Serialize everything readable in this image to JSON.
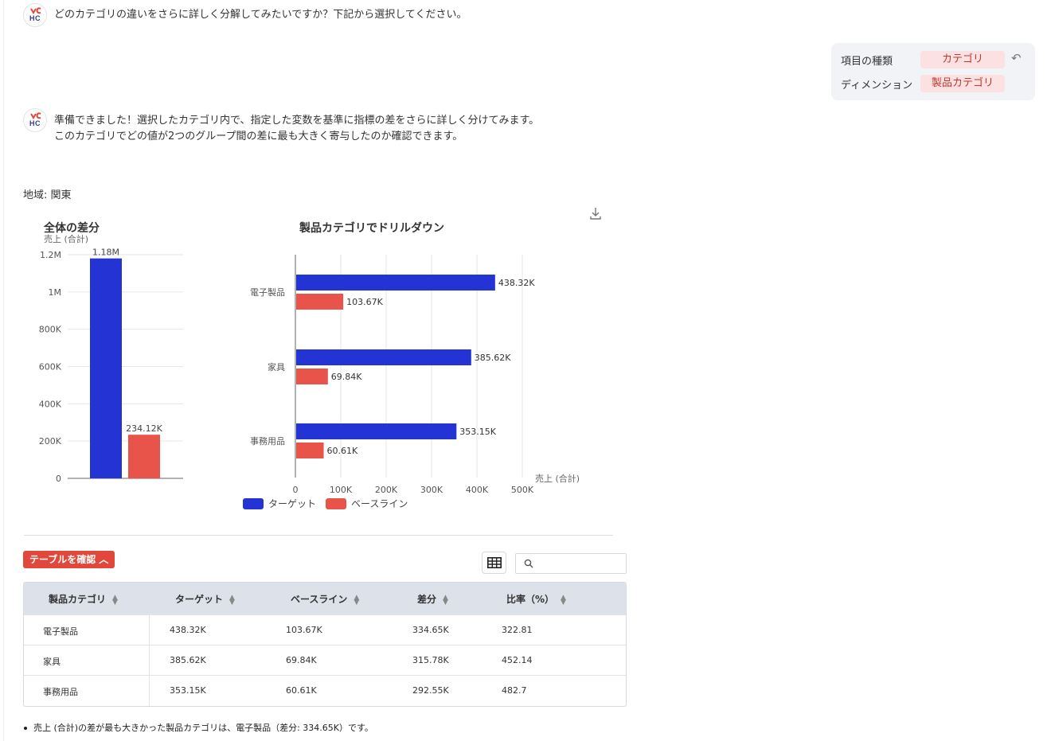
{
  "messages": {
    "q1": "どのカテゴリの違いをさらに詳しく分解してみたいですか？下記から選択してください。",
    "a1_line1": "準備できました！選択したカテゴリ内で、指定した変数を基準に指標の差をさらに詳しく分けてみます。",
    "a1_line2": "このカテゴリでどの値が2つのグループ間の差に最も大きく寄与したのか確認できます。"
  },
  "avatar": {
    "text": "HC"
  },
  "selection": {
    "type_label": "項目の種類",
    "type_value": "カテゴリ",
    "dimension_label": "ディメンション",
    "dimension_value": "製品カテゴリ",
    "undo_icon": "undo-icon"
  },
  "region": "地域: 関東",
  "colors": {
    "target": "#2433d4",
    "baseline": "#e8544a",
    "accent": "#e2473b"
  },
  "chart_data": [
    {
      "type": "bar",
      "title": "全体の差分",
      "ylabel": "売上 (合計)",
      "categories": [
        "ターゲット",
        "ベースライン"
      ],
      "values": [
        1180000,
        234120
      ],
      "value_labels": [
        "1.18M",
        "234.12K"
      ],
      "ylim": [
        0,
        1200000
      ],
      "yticks": [
        0,
        200000,
        400000,
        600000,
        800000,
        1000000,
        1200000
      ],
      "ytick_labels": [
        "0",
        "200K",
        "400K",
        "600K",
        "800K",
        "1M",
        "1.2M"
      ],
      "grid": true
    },
    {
      "type": "bar",
      "orientation": "horizontal",
      "title": "製品カテゴリでドリルダウン",
      "xlabel": "売上 (合計)",
      "categories": [
        "電子製品",
        "家具",
        "事務用品"
      ],
      "series": [
        {
          "name": "ターゲット",
          "values": [
            438320,
            385620,
            353150
          ],
          "labels": [
            "438.32K",
            "385.62K",
            "353.15K"
          ]
        },
        {
          "name": "ベースライン",
          "values": [
            103670,
            69840,
            60610
          ],
          "labels": [
            "103.67K",
            "69.84K",
            "60.61K"
          ]
        }
      ],
      "xlim": [
        0,
        500000
      ],
      "xticks": [
        0,
        100000,
        200000,
        300000,
        400000,
        500000
      ],
      "xtick_labels": [
        "0",
        "100K",
        "200K",
        "300K",
        "400K",
        "500K"
      ],
      "grid": true,
      "legend": "bottom-left"
    }
  ],
  "table_toggle": "テーブルを確認",
  "search": {
    "placeholder": ""
  },
  "table": {
    "headers": [
      "製品カテゴリ",
      "ターゲット",
      "ベースライン",
      "差分",
      "比率（%）"
    ],
    "rows": [
      [
        "電子製品",
        "438.32K",
        "103.67K",
        "334.65K",
        "322.81"
      ],
      [
        "家具",
        "385.62K",
        "69.84K",
        "315.78K",
        "452.14"
      ],
      [
        "事務用品",
        "353.15K",
        "60.61K",
        "292.55K",
        "482.7"
      ]
    ]
  },
  "summary": "売上 (合計)の差が最も大きかった製品カテゴリは、電子製品（差分: 334.65K）です。"
}
